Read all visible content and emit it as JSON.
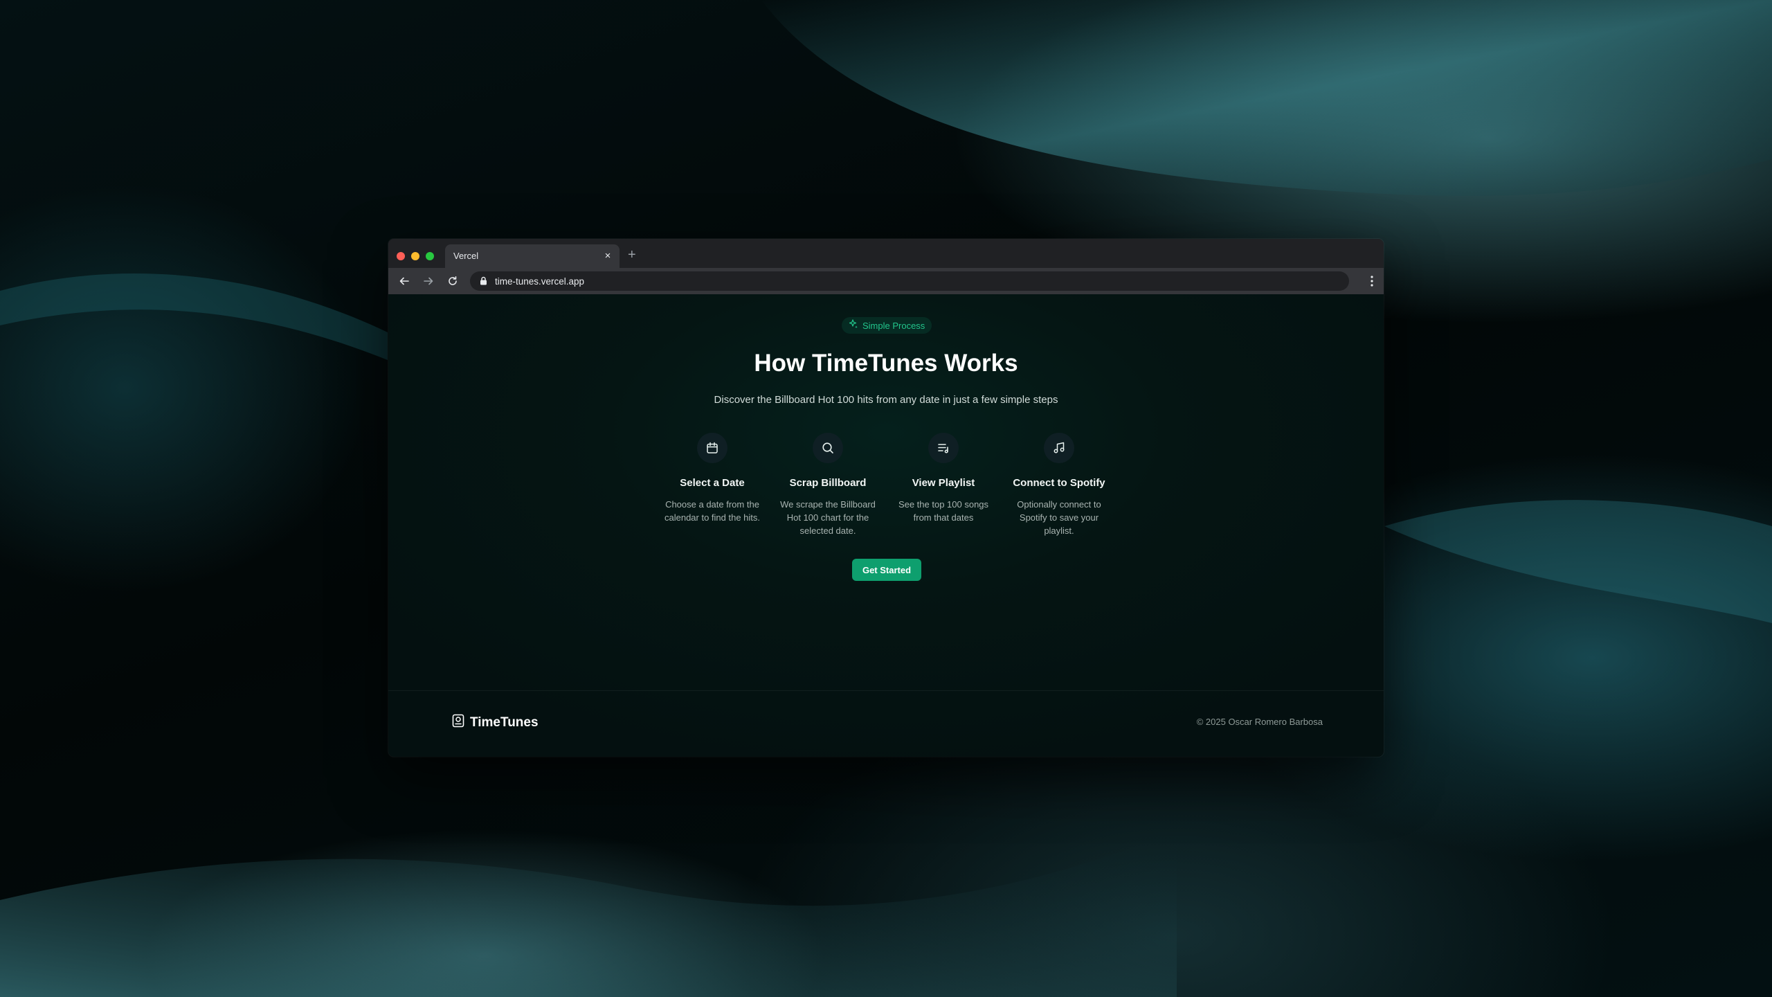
{
  "browser": {
    "tab_title": "Vercel",
    "tab_close": "×",
    "new_tab": "+",
    "url": "time-tunes.vercel.app"
  },
  "hero": {
    "badge": "Simple Process",
    "badge_icon": "sparkles-icon",
    "title": "How TimeTunes Works",
    "subtitle": "Discover the Billboard Hot 100 hits from any date in just a few simple steps"
  },
  "steps": [
    {
      "icon": "calendar-icon",
      "title": "Select a Date",
      "description": "Choose a date from the calendar to find the hits."
    },
    {
      "icon": "search-icon",
      "title": "Scrap Billboard",
      "description": "We scrape the Billboard Hot 100 chart for the selected date."
    },
    {
      "icon": "playlist-icon",
      "title": "View Playlist",
      "description": "See the top 100 songs from that dates"
    },
    {
      "icon": "music-note-icon",
      "title": "Connect to Spotify",
      "description": "Optionally connect to Spotify to save your playlist."
    }
  ],
  "cta": {
    "label": "Get Started"
  },
  "footer": {
    "brand": "TimeTunes",
    "brand_icon": "disc-icon",
    "copyright": "© 2025 Oscar Romero Barbosa"
  },
  "colors": {
    "accent": "#0e9f6e",
    "badge_text": "#22c58b",
    "page_bg": "#051513"
  }
}
